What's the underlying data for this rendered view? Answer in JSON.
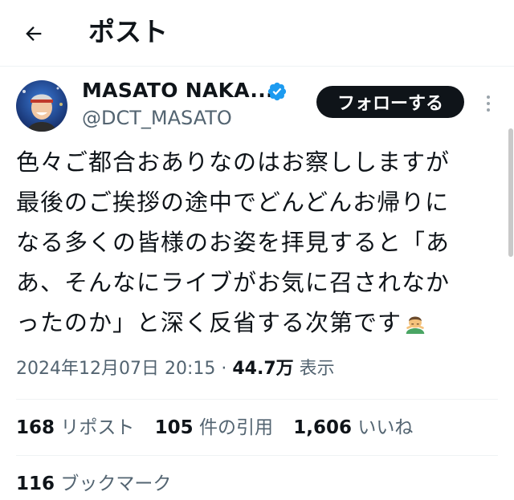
{
  "header": {
    "title": "ポスト",
    "back_icon": "arrow-left-icon"
  },
  "author": {
    "display_name": "MASATO NAKA...",
    "handle": "@DCT_MASATO",
    "verified_icon": "verified-badge-icon",
    "verified_color": "#1d9bf0"
  },
  "follow_button": {
    "label": "フォローする"
  },
  "more_icon": "more-vertical-icon",
  "tweet": {
    "lines": [
      "色々ご都合おありなのはお察ししますが",
      "最後のご挨拶の途中でどんどんお帰りに",
      "なる多くの皆様のお姿を拝見すると「あ",
      "あ、そんなにライブがお気に召されなか",
      "ったのか」と深く反省する次第です"
    ],
    "emoji": "bowing-man-emoji"
  },
  "meta": {
    "timestamp": "2024年12月07日 20:15",
    "separator": "·",
    "views_count": "44.7万",
    "views_label": "表示"
  },
  "stats": {
    "reposts_count": "168",
    "reposts_label": "リポスト",
    "quotes_count": "105",
    "quotes_label": "件の引用",
    "likes_count": "1,606",
    "likes_label": "いいね"
  },
  "bookmarks": {
    "count": "116",
    "label": "ブックマーク"
  },
  "colors": {
    "text": "#0f1419",
    "secondary": "#536471",
    "divider": "#eff3f4",
    "button_bg": "#0f1419"
  }
}
